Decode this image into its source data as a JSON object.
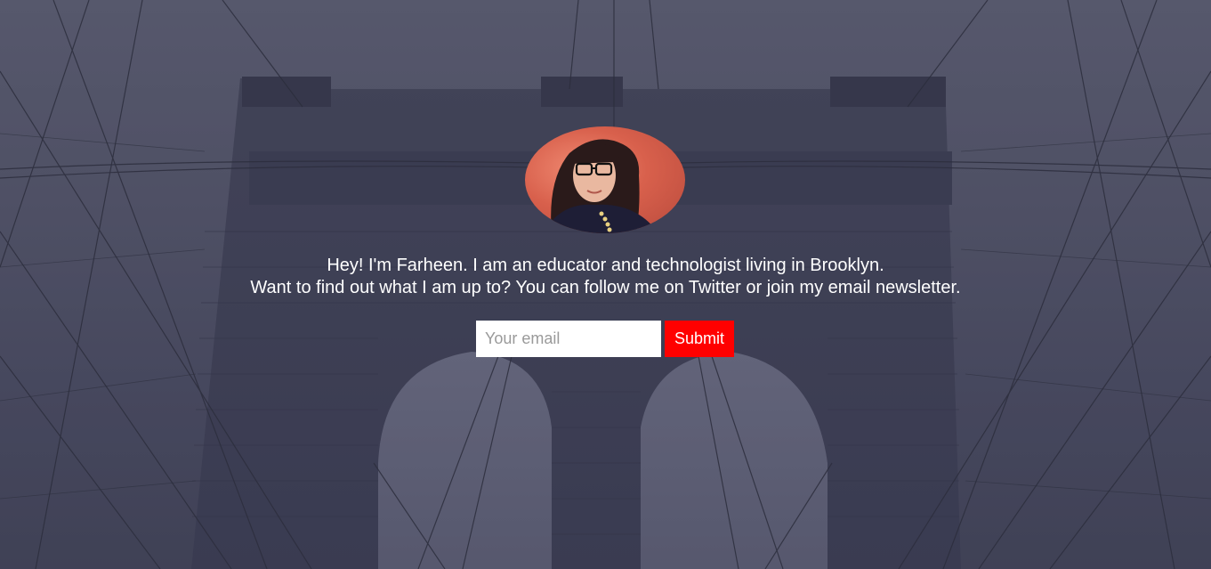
{
  "intro": {
    "line1": "Hey! I'm Farheen. I am an educator and technologist living in Brooklyn.",
    "line2": "Want to find out what I am up to? You can follow me on Twitter or join my email newsletter."
  },
  "signup": {
    "email_placeholder": "Your email",
    "submit_label": "Submit"
  },
  "colors": {
    "submit_button": "#ff0000",
    "text": "#ffffff",
    "background_tint": "#4a4c5c"
  }
}
